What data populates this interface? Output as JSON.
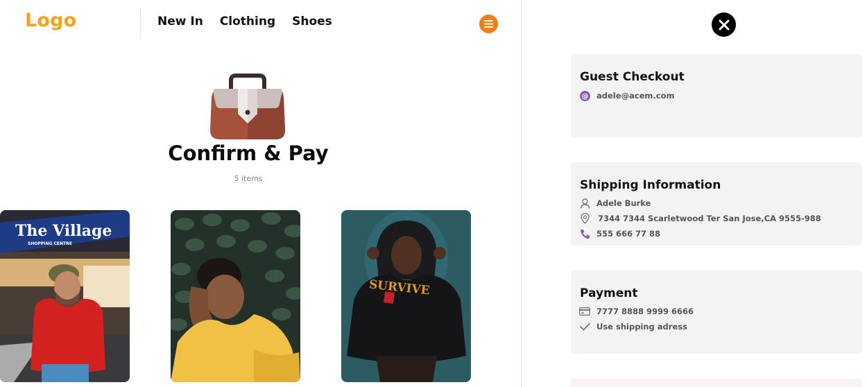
{
  "header": {
    "logo": "Logo",
    "nav": [
      "New In",
      "Clothing",
      "Shoes"
    ]
  },
  "main": {
    "title": "Confirm & Pay",
    "item_count": "5 items",
    "photo_sign_top": "The Village",
    "photo_sign_bottom": "SHOPPING CENTRE"
  },
  "guest_checkout": {
    "title": "Guest Checkout",
    "email": "adele@acem.com"
  },
  "shipping": {
    "title": "Shipping Information",
    "name": "Adele Burke",
    "address": "7344 7344 Scarletwood Ter San Jose,CA 9555-988",
    "phone": "555 666 77 88"
  },
  "payment": {
    "title": "Payment",
    "card": "7777 8888 9999 6666",
    "option": "Use shipping adress"
  },
  "colors": {
    "logo": "#f5a21b",
    "menu_button": "#f07f12",
    "accent_icon": "#8c5ea8",
    "card_bg": "#f4f3f4"
  },
  "icons": [
    "menu-icon",
    "close-icon",
    "bag-icon",
    "at-icon",
    "user-icon",
    "location-icon",
    "phone-icon",
    "credit-card-icon",
    "check-icon"
  ]
}
